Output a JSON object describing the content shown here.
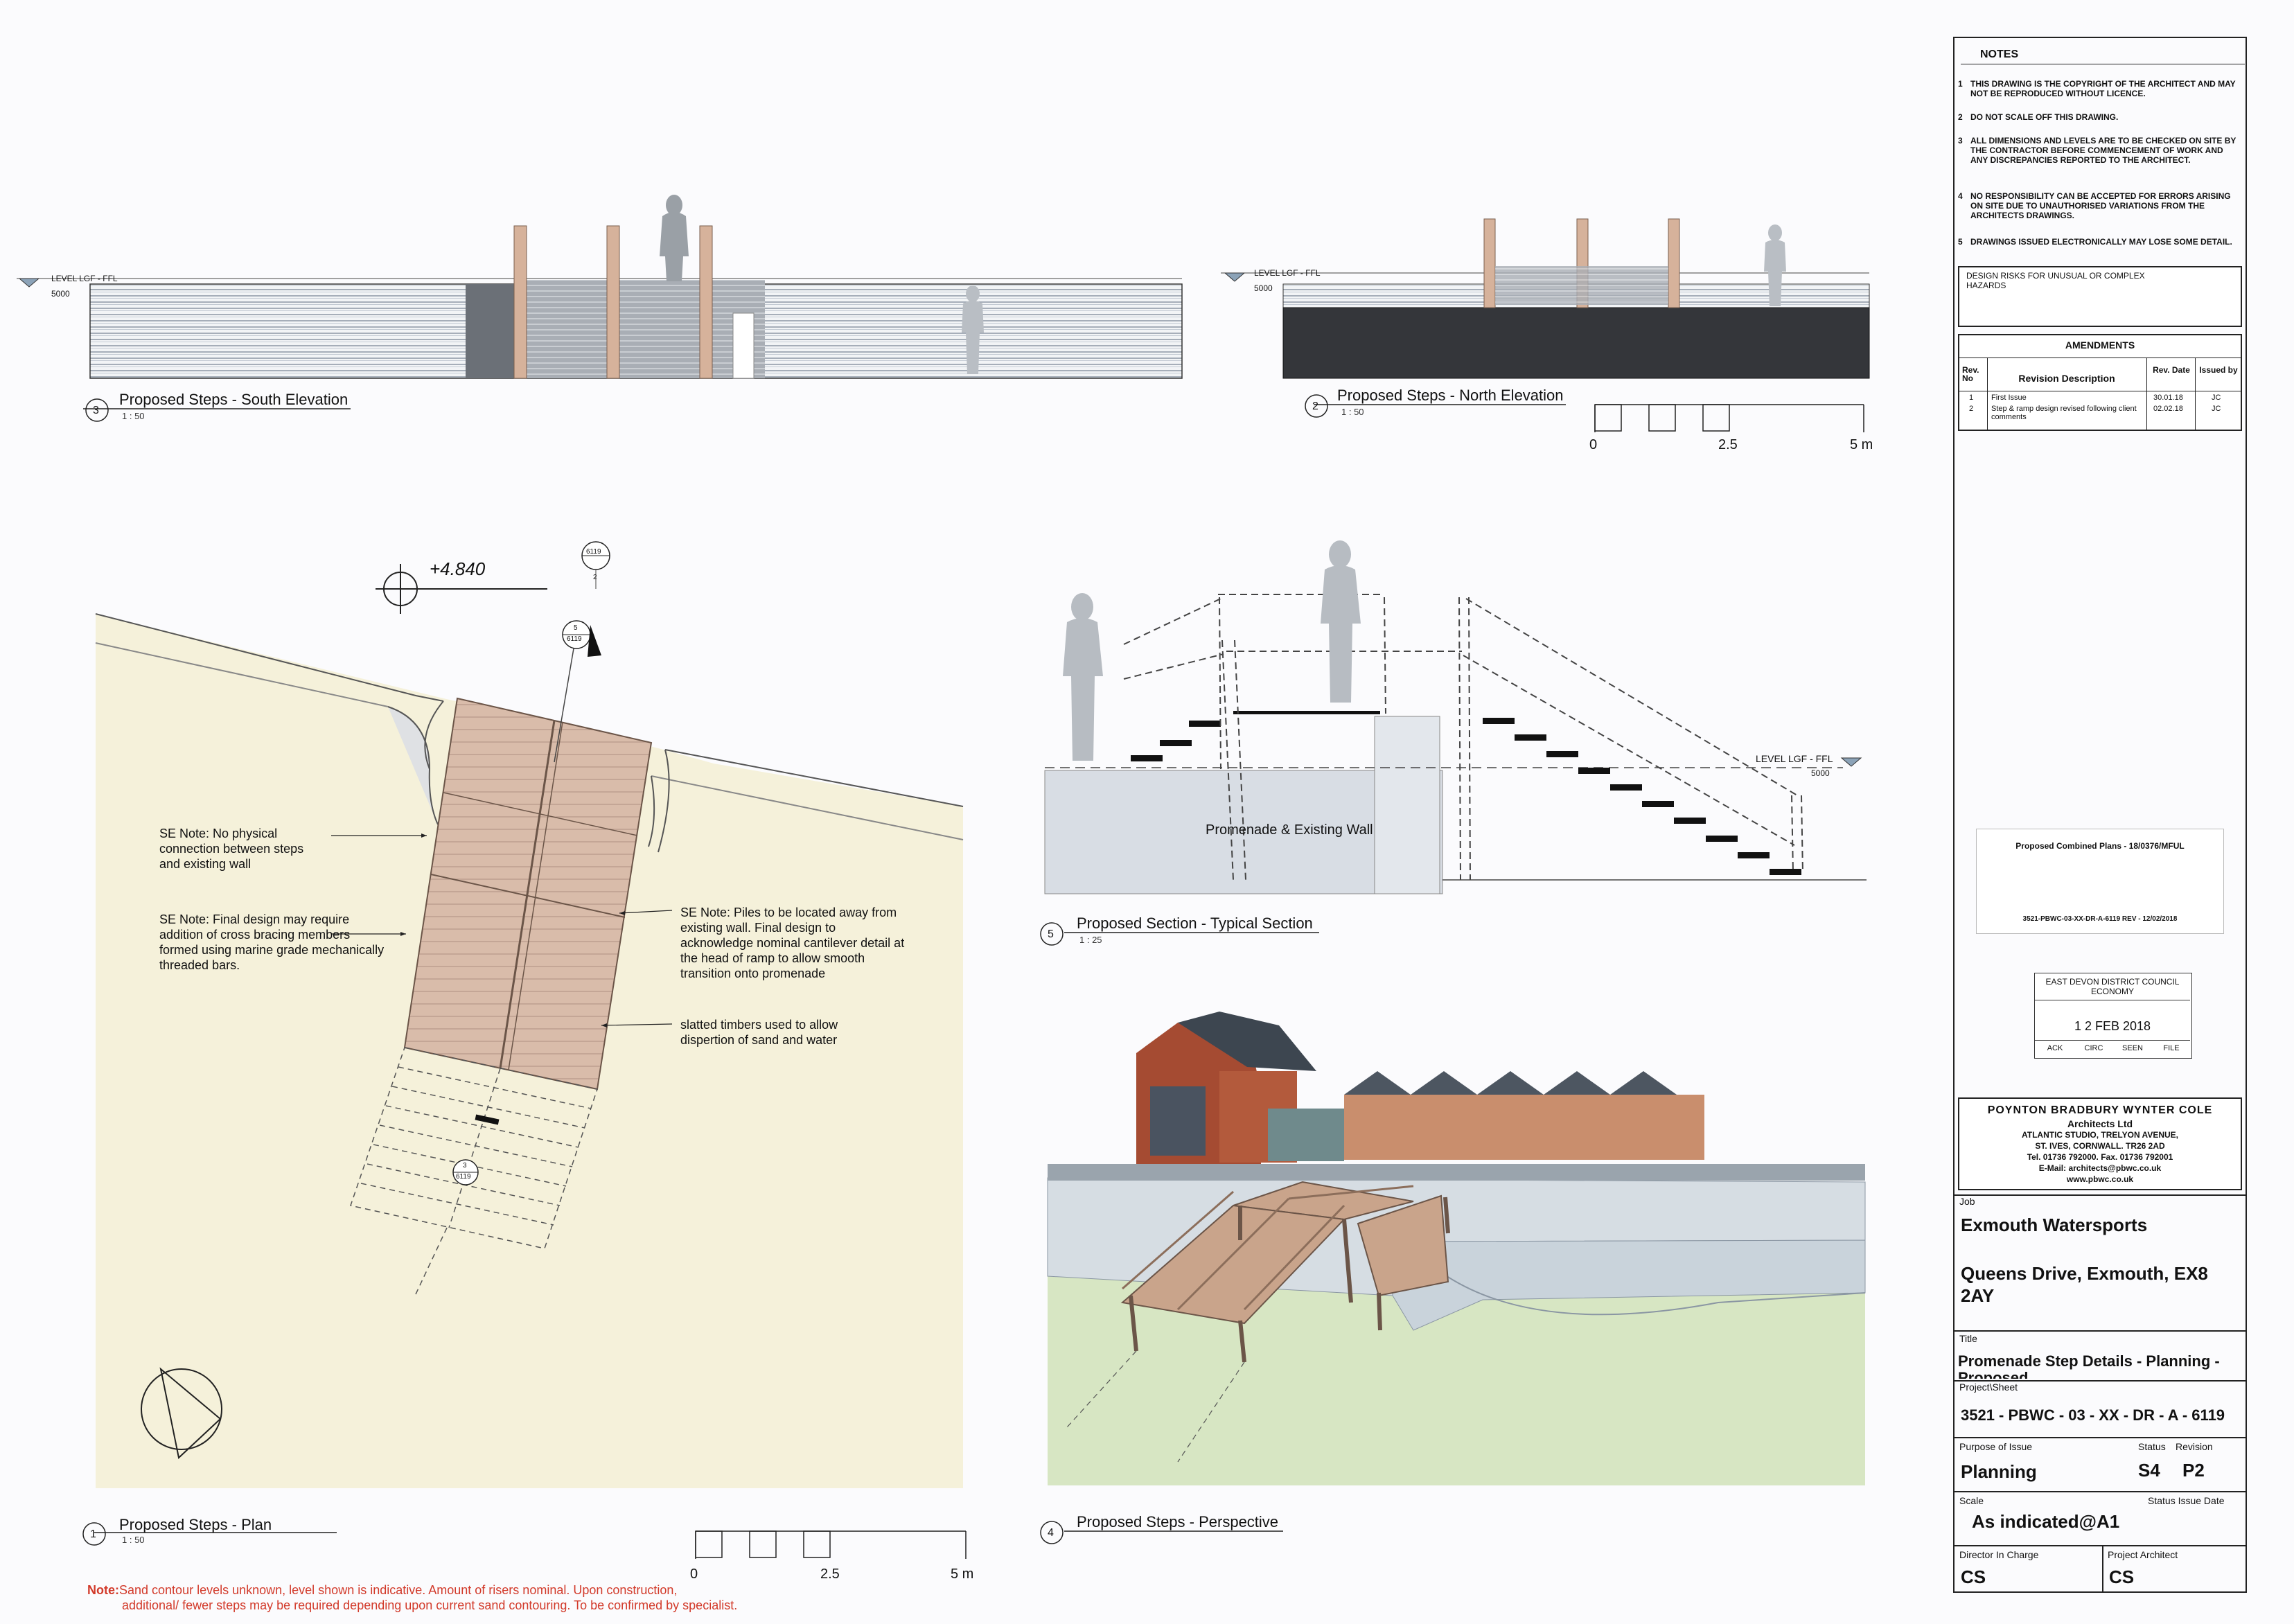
{
  "views": {
    "south": {
      "number": "3",
      "title": "Proposed Steps - South Elevation",
      "scale": "1 : 50",
      "level_label": "LEVEL LGF - FFL",
      "level_value": "5000"
    },
    "north": {
      "number": "2",
      "title": "Proposed Steps - North Elevation",
      "scale": "1 : 50",
      "level_label": "LEVEL LGF - FFL",
      "level_value": "5000"
    },
    "plan": {
      "number": "1",
      "title": "Proposed Steps - Plan",
      "scale": "1 : 50",
      "level_marker": "+4.840",
      "ref_top": "6119",
      "ref_top_sub": "2",
      "ref_mid": "5",
      "ref_mid_sub": "6119",
      "ref_bottom": "3",
      "ref_bottom_sub": "6119"
    },
    "section": {
      "number": "5",
      "title": "Proposed Section - Typical Section",
      "scale": "1 : 25",
      "wall_label": "Promenade & Existing Wall",
      "level_label": "LEVEL LGF - FFL",
      "level_value": "5000"
    },
    "perspective": {
      "number": "4",
      "title": "Proposed Steps - Perspective"
    }
  },
  "scale_bars": {
    "north": {
      "zero": "0",
      "mid": "2.5",
      "end": "5 m"
    },
    "plan": {
      "zero": "0",
      "mid": "2.5",
      "end": "5 m"
    }
  },
  "annotations": {
    "se_note_1": "SE Note: No physical connection between steps and existing wall",
    "se_note_2": "SE Note: Final design may require addition of cross bracing members formed using marine grade mechanically threaded bars.",
    "se_note_3": "SE Note: Piles to be located away from existing wall. Final design to acknowledge nominal cantilever detail at the head of ramp to allow smooth transition onto promenade",
    "slatted": "slatted timbers used to allow dispertion of sand and water"
  },
  "footnote": {
    "label": "Note:",
    "line1": "Sand contour levels unknown, level shown is indicative. Amount of risers nominal. Upon construction,",
    "line2": "additional/ fewer steps may be required depending upon current sand contouring. To be confirmed by specialist."
  },
  "notes": {
    "heading": "NOTES",
    "items": [
      {
        "num": "1",
        "text": "THIS DRAWING IS THE COPYRIGHT OF THE ARCHITECT AND MAY NOT BE REPRODUCED WITHOUT LICENCE."
      },
      {
        "num": "2",
        "text": "DO NOT SCALE OFF THIS DRAWING."
      },
      {
        "num": "3",
        "text": "ALL DIMENSIONS AND LEVELS ARE TO BE CHECKED ON SITE BY THE CONTRACTOR BEFORE COMMENCEMENT OF WORK AND ANY DISCREPANCIES REPORTED TO THE ARCHITECT."
      },
      {
        "num": "4",
        "text": "NO RESPONSIBILITY CAN BE ACCEPTED FOR ERRORS ARISING ON SITE DUE TO UNAUTHORISED VARIATIONS FROM THE ARCHITECTS DRAWINGS."
      },
      {
        "num": "5",
        "text": "DRAWINGS ISSUED ELECTRONICALLY MAY LOSE SOME DETAIL."
      }
    ],
    "design_risks": "DESIGN RISKS FOR UNUSUAL OR COMPLEX HAZARDS"
  },
  "amendments": {
    "heading": "AMENDMENTS",
    "headers": [
      "Rev. No",
      "Revision Description",
      "Rev. Date",
      "Issued by"
    ],
    "rows": [
      [
        "1",
        "First Issue",
        "30.01.18",
        "JC"
      ],
      [
        "2",
        "Step & ramp design revised following client comments",
        "02.02.18",
        "JC"
      ]
    ]
  },
  "planning_label": {
    "title": "Proposed Combined Plans - 18/0376/MFUL",
    "ref": "3521-PBWC-03-XX-DR-A-6119 REV - 12/02/2018"
  },
  "stamp": {
    "line1": "EAST DEVON DISTRICT COUNCIL",
    "line2": "ECONOMY",
    "date": "1 2 FEB 2018",
    "cells": [
      "ACK",
      "CIRC",
      "SEEN",
      "FILE"
    ]
  },
  "architect": {
    "name": "POYNTON BRADBURY WYNTER COLE",
    "company": "Architects Ltd",
    "address1": "ATLANTIC STUDIO, TRELYON AVENUE,",
    "address2": "ST. IVES, CORNWALL. TR26 2AD",
    "tel": "Tel. 01736 792000. Fax. 01736 792001",
    "email": "E-Mail: architects@pbwc.co.uk",
    "web": "www.pbwc.co.uk"
  },
  "title_block": {
    "job_label": "Job",
    "job_name": "Exmouth Watersports",
    "job_address_1": "Queens Drive, Exmouth, EX8",
    "job_address_2": "2AY",
    "title_label": "Title",
    "title_1": "Promenade Step Details - Planning -",
    "title_2": "Proposed",
    "project_label": "Project\\Sheet",
    "project_number": "3521 - PBWC - 03 - XX - DR - A - 6119",
    "purpose_label": "Purpose of Issue",
    "purpose": "Planning",
    "status_label": "Status",
    "status": "S4",
    "revision_label": "Revision",
    "revision": "P2",
    "scale_label": "Scale",
    "scale": "As indicated@A1",
    "status_date_label": "Status Issue Date",
    "director_label": "Director In Charge",
    "director": "CS",
    "architect_label": "Project Architect",
    "architect": "CS"
  },
  "colors": {
    "sand": "#f4f0d9",
    "timber": "#d8b9a8",
    "water": "#d7e6c3",
    "stone": "#d9dde3"
  }
}
